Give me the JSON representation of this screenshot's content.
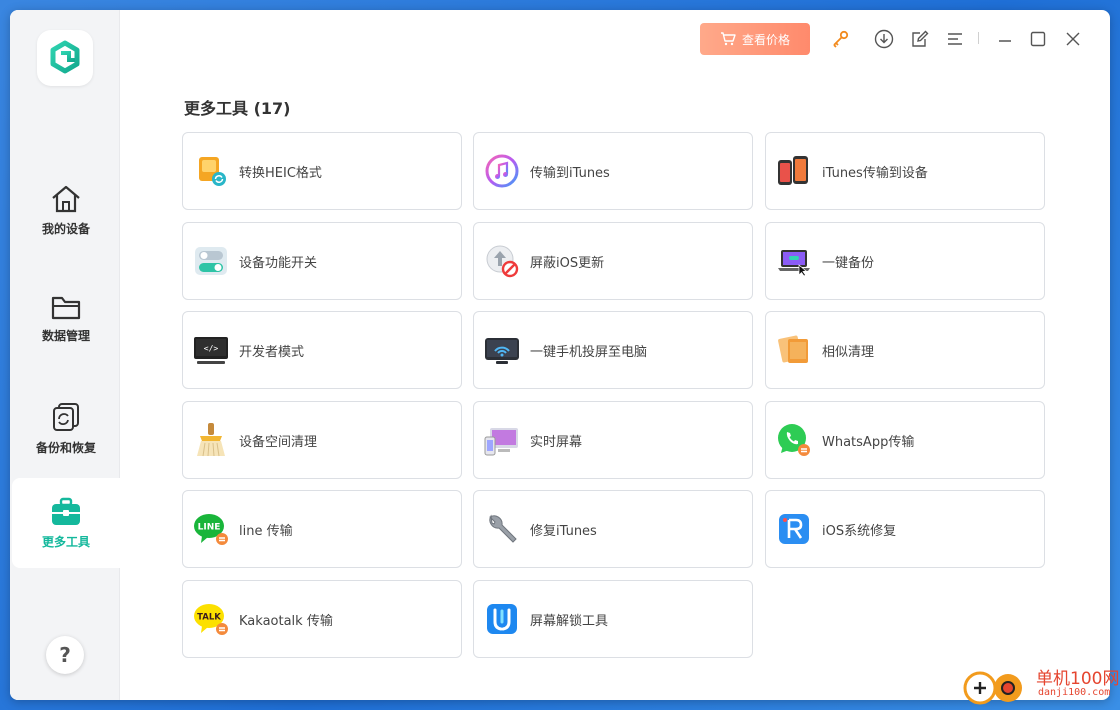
{
  "app": {
    "price_button_label": "查看价格",
    "accent": "#14b89c",
    "price_gradient": [
      "#ffa98a",
      "#ff8a6c"
    ]
  },
  "sidebar": {
    "items": [
      {
        "label": "我的设备",
        "icon": "home-icon",
        "active": false
      },
      {
        "label": "数据管理",
        "icon": "folder-icon",
        "active": false
      },
      {
        "label": "备份和恢复",
        "icon": "backup-restore-icon",
        "active": false
      },
      {
        "label": "更多工具",
        "icon": "toolbox-icon",
        "active": true
      }
    ],
    "help_label": "?"
  },
  "main": {
    "section_title": "更多工具 (17)",
    "tools": [
      {
        "label": "转换HEIC格式",
        "icon": "heic-convert-icon"
      },
      {
        "label": "传输到iTunes",
        "icon": "itunes-icon"
      },
      {
        "label": "iTunes传输到设备",
        "icon": "phone-transfer-icon"
      },
      {
        "label": "设备功能开关",
        "icon": "toggle-switch-icon"
      },
      {
        "label": "屏蔽iOS更新",
        "icon": "block-update-icon"
      },
      {
        "label": "一键备份",
        "icon": "laptop-backup-icon"
      },
      {
        "label": "开发者模式",
        "icon": "developer-monitor-icon"
      },
      {
        "label": "一键手机投屏至电脑",
        "icon": "screen-cast-icon"
      },
      {
        "label": "相似清理",
        "icon": "similar-photos-icon"
      },
      {
        "label": "设备空间清理",
        "icon": "broom-icon"
      },
      {
        "label": "实时屏幕",
        "icon": "live-screen-icon"
      },
      {
        "label": "WhatsApp传输",
        "icon": "whatsapp-icon"
      },
      {
        "label": "line 传输",
        "icon": "line-icon"
      },
      {
        "label": "修复iTunes",
        "icon": "wrench-icon"
      },
      {
        "label": "iOS系统修复",
        "icon": "ios-repair-icon"
      },
      {
        "label": "Kakaotalk 传输",
        "icon": "kakaotalk-icon"
      },
      {
        "label": "屏幕解锁工具",
        "icon": "screen-unlock-icon"
      }
    ]
  },
  "watermark": {
    "title": "单机100网",
    "url": "danji100.com"
  }
}
